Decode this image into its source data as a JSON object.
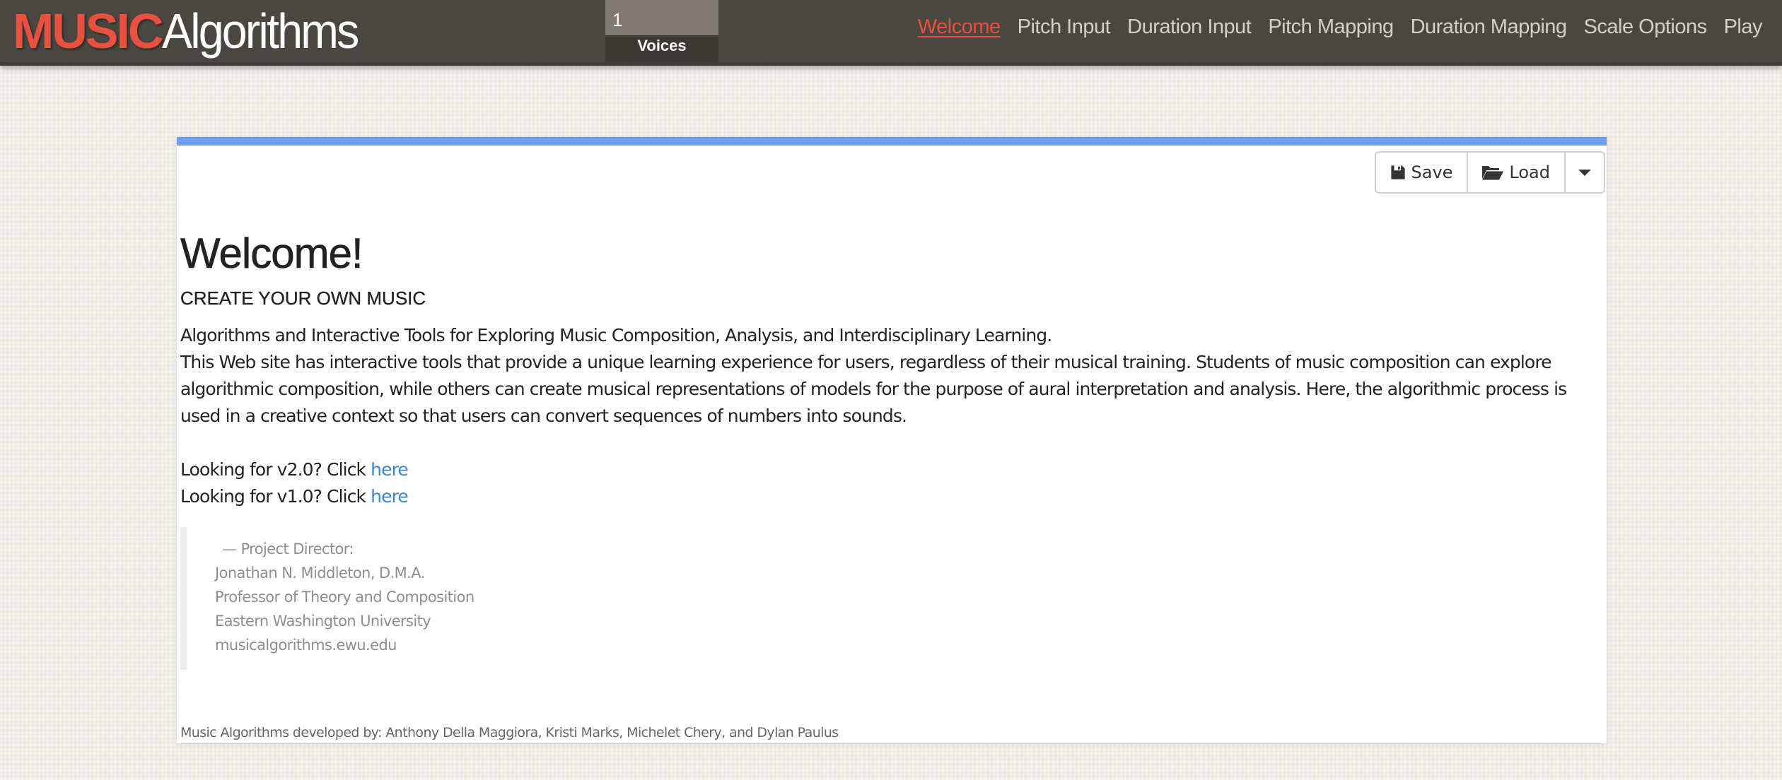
{
  "navbar": {
    "brand_bold": "MUSIC",
    "brand_light": "Algorithms",
    "voices_value": "1",
    "voices_label": "Voices",
    "links": [
      {
        "label": "Welcome",
        "active": true
      },
      {
        "label": "Pitch Input",
        "active": false
      },
      {
        "label": "Duration Input",
        "active": false
      },
      {
        "label": "Pitch Mapping",
        "active": false
      },
      {
        "label": "Duration Mapping",
        "active": false
      },
      {
        "label": "Scale Options",
        "active": false
      },
      {
        "label": "Play",
        "active": false
      }
    ]
  },
  "toolbar": {
    "save_label": "Save",
    "load_label": "Load",
    "save_icon": "floppy-disk-icon",
    "load_icon": "folder-open-icon",
    "dropdown_icon": "caret-down-icon"
  },
  "main": {
    "title": "Welcome!",
    "subtitle": "CREATE YOUR OWN MUSIC",
    "tagline": "Algorithms and Interactive Tools for Exploring Music Composition, Analysis, and Interdisciplinary Learning.",
    "description": "This Web site has interactive tools that provide a unique learning experience for users, regardless of their musical training. Students of music composition can explore algorithmic composition, while others can create musical representations of models for the purpose of aural interpretation and analysis. Here, the algorithmic process is used in a creative context so that users can convert sequences of numbers into sounds.",
    "version_links": [
      {
        "prefix": "Looking for v2.0? Click ",
        "link": "here"
      },
      {
        "prefix": "Looking for v1.0? Click ",
        "link": "here"
      }
    ],
    "quote": {
      "role": "— Project Director:",
      "lines": [
        "Jonathan N. Middleton, D.M.A.",
        "Professor of Theory and Composition",
        "Eastern Washington University",
        "musicalgorithms.ewu.edu"
      ]
    },
    "credits": "Music Algorithms developed by: Anthony Della Maggiora, Kristi Marks, Michelet Chery, and Dylan Paulus"
  },
  "colors": {
    "brand_red": "#e8503f",
    "navbar_bg": "#4a4640",
    "accent_bar": "#6e9ff5",
    "link_blue": "#3a88d0"
  }
}
